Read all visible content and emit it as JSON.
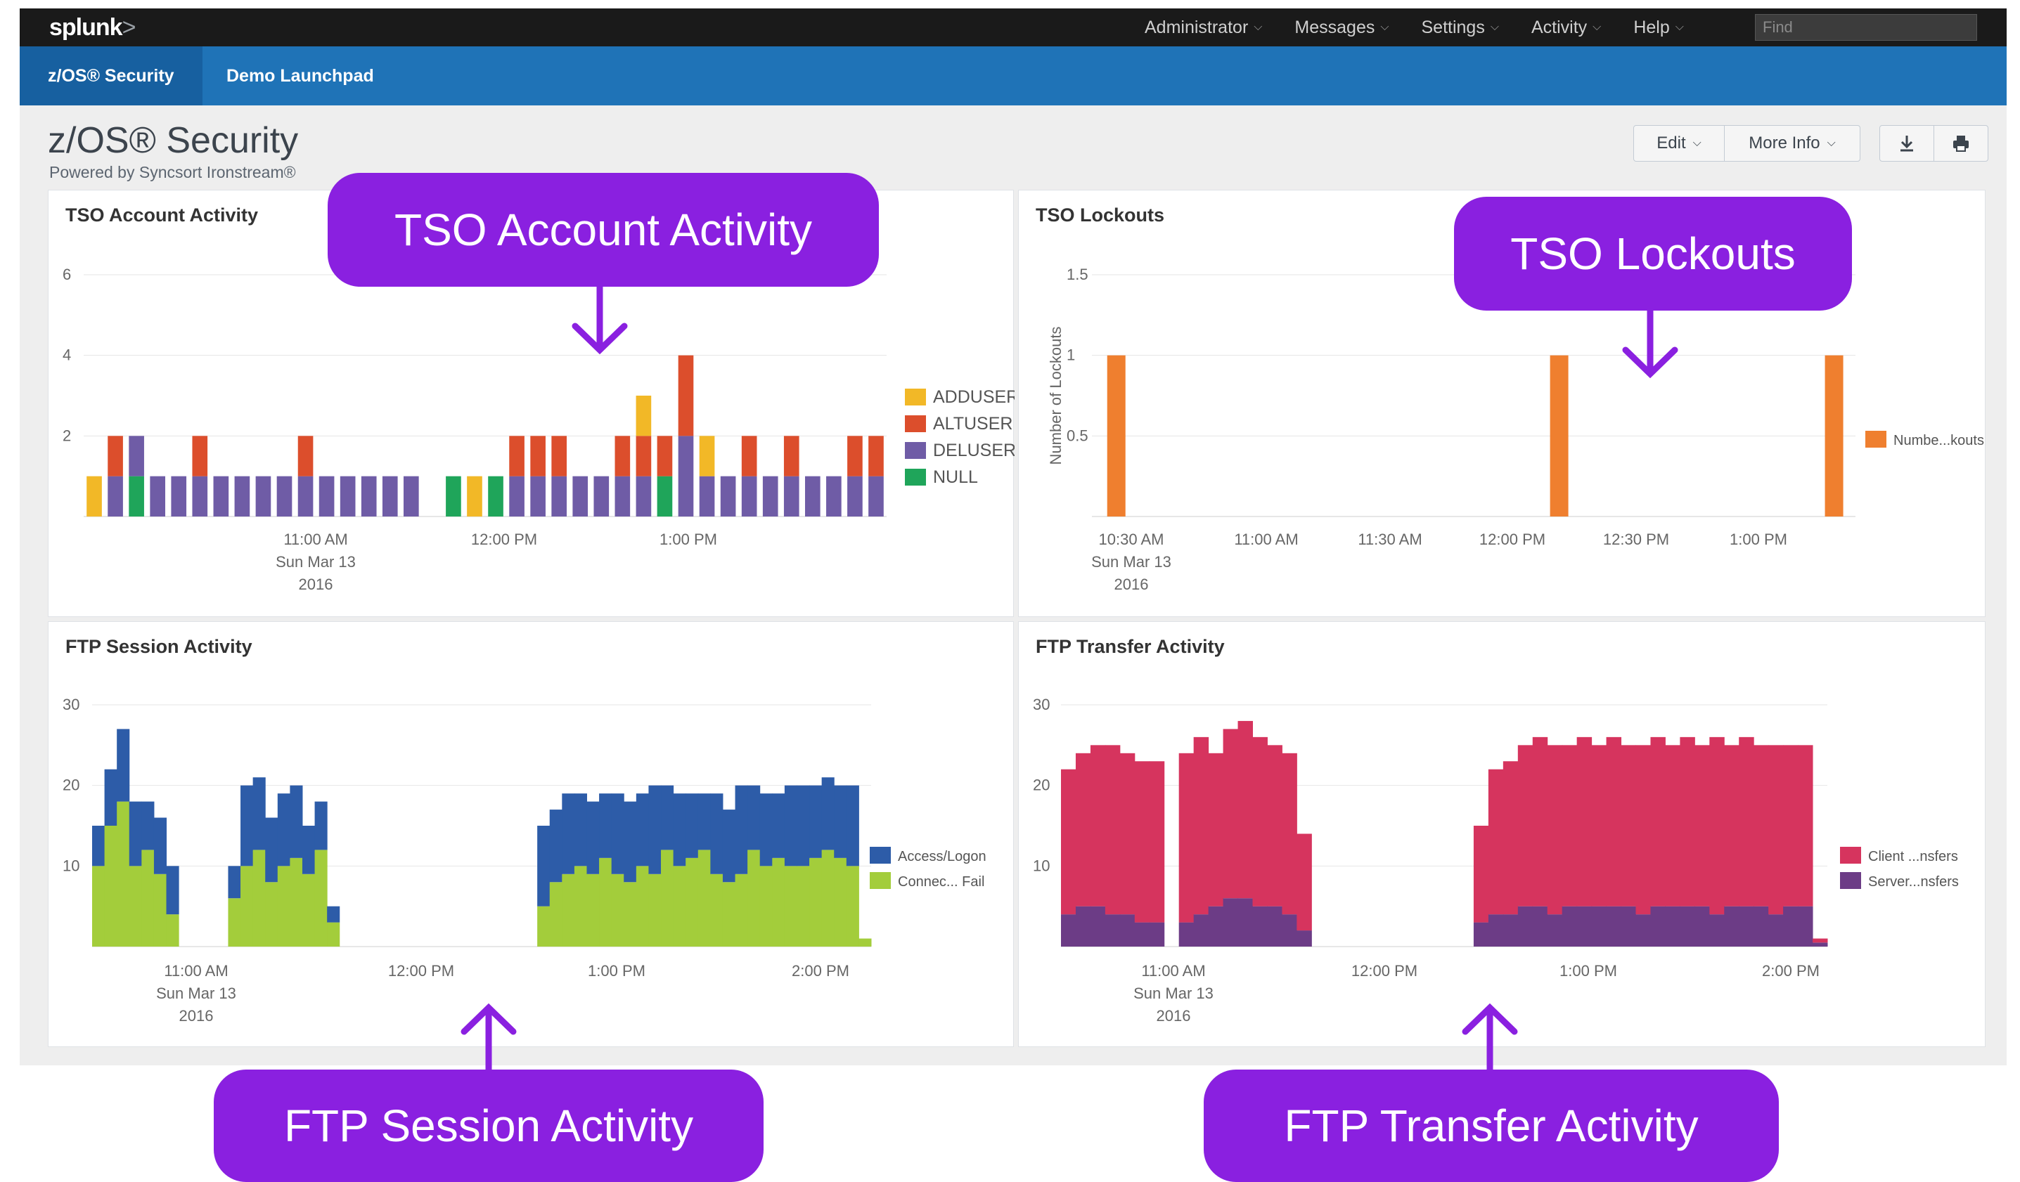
{
  "topbar": {
    "logo": "splunk",
    "logo_chevron": ">",
    "menu": [
      {
        "label": "Administrator"
      },
      {
        "label": "Messages"
      },
      {
        "label": "Settings"
      },
      {
        "label": "Activity"
      },
      {
        "label": "Help"
      }
    ],
    "search_placeholder": "Find"
  },
  "appbar": {
    "tabs": [
      {
        "label": "z/OS® Security",
        "active": true
      },
      {
        "label": "Demo Launchpad",
        "active": false
      }
    ]
  },
  "page": {
    "title": "z/OS® Security",
    "subtitle": "Powered by Syncsort Ironstream®"
  },
  "toolbar": {
    "edit_label": "Edit",
    "more_info_label": "More Info",
    "export_icon": "download-icon",
    "print_icon": "print-icon"
  },
  "colors": {
    "adduser": "#f2b827",
    "altuser": "#dc4e2c",
    "deluser": "#6f5ca6",
    "null": "#1fa55a",
    "lockouts": "#ef7f2f",
    "access_logon": "#2d5ca8",
    "connect_fail": "#a3cd3b",
    "client_transfers": "#d6345e",
    "server_transfers": "#6c3c86",
    "callout": "#8a20e0"
  },
  "panels": {
    "tso_account": {
      "title": "TSO Account Activity",
      "chart_data": {
        "type": "bar",
        "stacked": true,
        "x_ticks": [
          "11:00 AM\nSun Mar 13\n2016",
          "12:00 PM",
          "1:00 PM"
        ],
        "ylim": [
          0,
          6
        ],
        "y_ticks": [
          2,
          4,
          6
        ],
        "legend_position": "right",
        "series": [
          {
            "name": "ADDUSER",
            "values": [
              1,
              0,
              0,
              0,
              0,
              0,
              0,
              0,
              0,
              0,
              0,
              0,
              0,
              0,
              0,
              0,
              0,
              0,
              1,
              0,
              0,
              0,
              0,
              0,
              0,
              0,
              1,
              0,
              0,
              1,
              0,
              0,
              0,
              0,
              0,
              0,
              0,
              0
            ]
          },
          {
            "name": "ALTUSER",
            "values": [
              0,
              1,
              0,
              0,
              0,
              1,
              0,
              0,
              0,
              0,
              1,
              0,
              0,
              0,
              0,
              0,
              0,
              0,
              0,
              0,
              1,
              1,
              1,
              0,
              0,
              1,
              1,
              1,
              2,
              0,
              0,
              1,
              0,
              1,
              0,
              0,
              1,
              1
            ]
          },
          {
            "name": "DELUSER",
            "values": [
              0,
              1,
              1,
              1,
              1,
              1,
              1,
              1,
              1,
              1,
              1,
              1,
              1,
              1,
              1,
              1,
              0,
              0,
              0,
              0,
              1,
              1,
              1,
              1,
              1,
              1,
              1,
              0,
              2,
              1,
              1,
              1,
              1,
              1,
              1,
              1,
              1,
              1
            ]
          },
          {
            "name": "NULL",
            "values": [
              0,
              0,
              1,
              0,
              0,
              0,
              0,
              0,
              0,
              0,
              0,
              0,
              0,
              0,
              0,
              0,
              0,
              1,
              0,
              1,
              0,
              0,
              0,
              0,
              0,
              0,
              0,
              1,
              0,
              0,
              0,
              0,
              0,
              0,
              0,
              0,
              0,
              0
            ]
          }
        ]
      }
    },
    "tso_lockouts": {
      "title": "TSO Lockouts",
      "chart_data": {
        "type": "bar",
        "ylabel": "Number of Lockouts",
        "ylim": [
          0,
          1.5
        ],
        "y_ticks": [
          0.5,
          1,
          1.5
        ],
        "x_ticks": [
          "10:30 AM\nSun Mar 13\n2016",
          "11:00 AM",
          "11:30 AM",
          "12:00 PM",
          "12:30 PM",
          "1:00 PM"
        ],
        "legend_position": "right",
        "series": [
          {
            "name": "Numbe...kouts",
            "x_fraction": [
              0.02,
              0.6,
              0.96
            ],
            "values": [
              1,
              1,
              1
            ]
          }
        ]
      }
    },
    "ftp_session": {
      "title": "FTP Session Activity",
      "chart_data": {
        "type": "area",
        "stacked": true,
        "x_ticks": [
          "11:00 AM\nSun Mar 13\n2016",
          "12:00 PM",
          "1:00 PM",
          "2:00 PM"
        ],
        "ylim": [
          0,
          30
        ],
        "y_ticks": [
          10,
          20,
          30
        ],
        "legend_position": "right",
        "series": [
          {
            "name": "Access/Logon",
            "values": [
              5,
              7,
              9,
              8,
              6,
              7,
              6,
              0,
              0,
              0,
              0,
              4,
              10,
              9,
              8,
              9,
              9,
              6,
              6,
              2,
              0,
              0,
              0,
              0,
              0,
              0,
              0,
              0,
              0,
              0,
              0,
              0,
              0,
              0,
              0,
              0,
              10,
              9,
              10,
              9,
              9,
              8,
              10,
              10,
              9,
              11,
              8,
              9,
              8,
              7,
              10,
              9,
              11,
              8,
              9,
              8,
              10,
              10,
              9,
              9,
              9,
              10,
              0
            ]
          },
          {
            "name": "Connec... Fail",
            "values": [
              10,
              15,
              18,
              10,
              12,
              9,
              4,
              0,
              0,
              0,
              0,
              6,
              10,
              12,
              8,
              10,
              11,
              9,
              12,
              3,
              0,
              0,
              0,
              0,
              0,
              0,
              0,
              0,
              0,
              0,
              0,
              0,
              0,
              0,
              0,
              0,
              5,
              8,
              9,
              10,
              9,
              11,
              9,
              8,
              10,
              9,
              12,
              10,
              11,
              12,
              9,
              8,
              9,
              12,
              10,
              11,
              10,
              10,
              11,
              12,
              11,
              10,
              1
            ]
          }
        ]
      }
    },
    "ftp_transfer": {
      "title": "FTP Transfer Activity",
      "chart_data": {
        "type": "area",
        "stacked": true,
        "x_ticks": [
          "11:00 AM\nSun Mar 13\n2016",
          "12:00 PM",
          "1:00 PM",
          "2:00 PM"
        ],
        "ylim": [
          0,
          30
        ],
        "y_ticks": [
          10,
          20,
          30
        ],
        "legend_position": "right",
        "series": [
          {
            "name": "Client ...nsfers",
            "values": [
              18,
              19,
              20,
              21,
              20,
              20,
              20,
              0,
              21,
              22,
              19,
              21,
              22,
              21,
              20,
              20,
              12,
              0,
              0,
              0,
              0,
              0,
              0,
              0,
              0,
              0,
              0,
              0,
              12,
              18,
              19,
              20,
              21,
              21,
              20,
              21,
              20,
              21,
              20,
              21,
              21,
              20,
              21,
              20,
              22,
              20,
              21,
              20,
              21,
              20,
              20,
              0.5
            ]
          },
          {
            "name": "Server...nsfers",
            "values": [
              4,
              5,
              5,
              4,
              4,
              3,
              3,
              0,
              3,
              4,
              5,
              6,
              6,
              5,
              5,
              4,
              2,
              0,
              0,
              0,
              0,
              0,
              0,
              0,
              0,
              0,
              0,
              0,
              3,
              4,
              4,
              5,
              5,
              4,
              5,
              5,
              5,
              5,
              5,
              4,
              5,
              5,
              5,
              5,
              4,
              5,
              5,
              5,
              4,
              5,
              5,
              0.5
            ]
          }
        ]
      }
    }
  },
  "callouts": {
    "tso_account": "TSO Account Activity",
    "tso_lockouts": "TSO Lockouts",
    "ftp_session": "FTP Session Activity",
    "ftp_transfer": "FTP Transfer Activity"
  }
}
